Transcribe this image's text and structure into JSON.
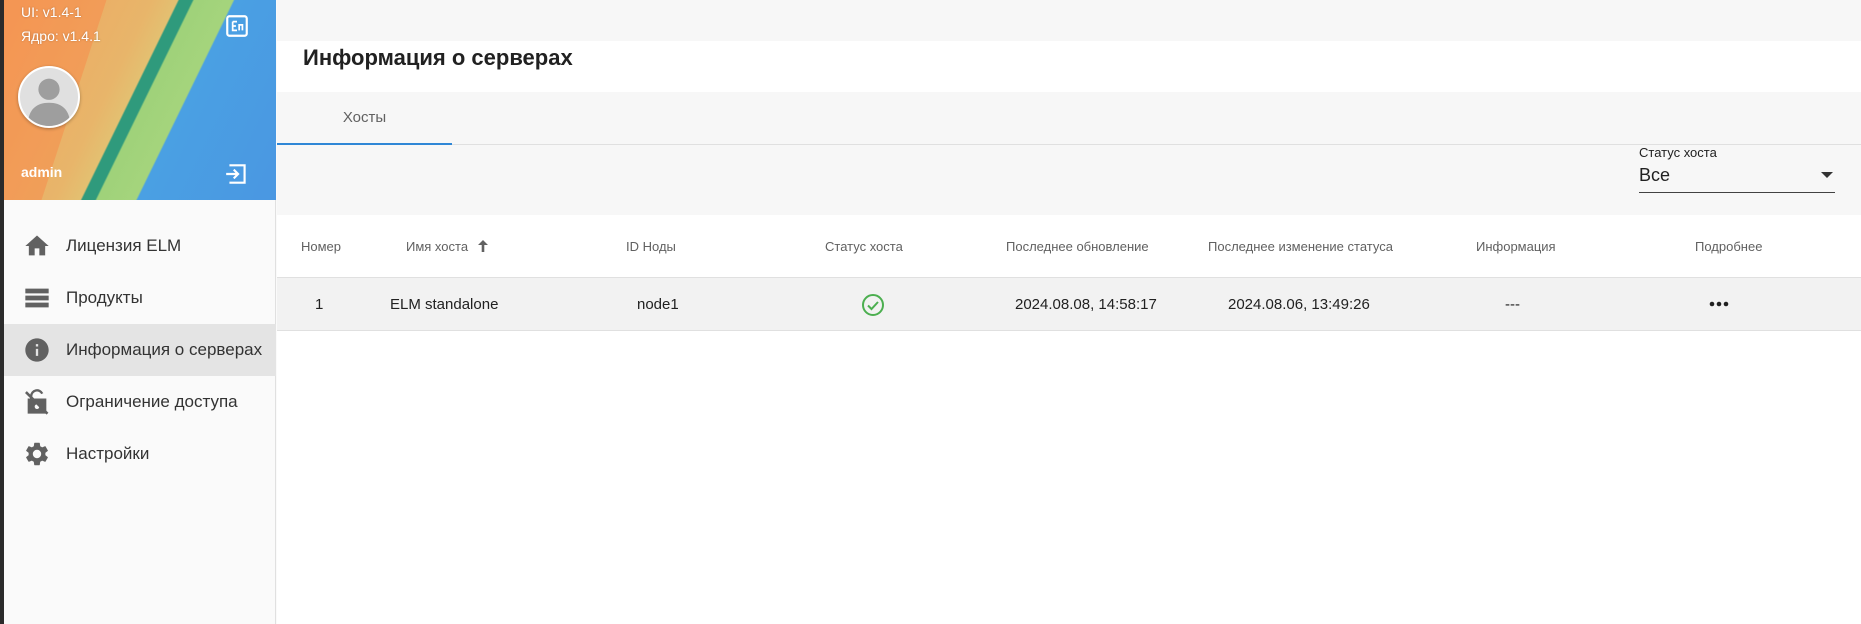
{
  "sidebar": {
    "ui_version": "UI: v1.4-1",
    "core_version": "Ядро: v1.4.1",
    "user_name": "admin",
    "items": [
      {
        "label": "Лицензия ELM",
        "icon": "home-icon"
      },
      {
        "label": "Продукты",
        "icon": "list-icon"
      },
      {
        "label": "Информация о серверах",
        "icon": "info-icon",
        "active": true
      },
      {
        "label": "Ограничение доступа",
        "icon": "lock-off-icon"
      },
      {
        "label": "Настройки",
        "icon": "gear-icon"
      }
    ]
  },
  "main": {
    "title": "Информация о серверах",
    "tabs": [
      {
        "label": "Хосты",
        "active": true
      }
    ],
    "filter": {
      "label": "Статус хоста",
      "value": "Все"
    },
    "table": {
      "columns": [
        "Номер",
        "Имя хоста",
        "ID Ноды",
        "Статус хоста",
        "Последнее обновление",
        "Последнее изменение статуса",
        "Информация",
        "Подробнее"
      ],
      "sort_column": "Имя хоста",
      "sort_direction": "asc",
      "rows": [
        {
          "number": "1",
          "host": "ELM standalone",
          "node": "node1",
          "status": "ok",
          "last_update": "2024.08.08, 14:58:17",
          "last_status_change": "2024.08.06, 13:49:26",
          "info": "---"
        }
      ]
    }
  },
  "colors": {
    "accent": "#2f87d6",
    "status_ok": "#4caf50",
    "active_nav_bg": "#e4e4e4"
  }
}
